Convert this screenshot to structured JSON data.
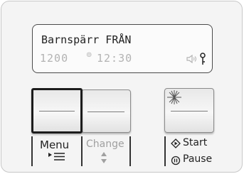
{
  "display": {
    "line1": "Barnspärr FRÅN",
    "spin_speed": "1200",
    "time": "12:30",
    "icons": [
      "spin-icon",
      "sound-icon",
      "key-icon"
    ]
  },
  "buttons": {
    "menu": {
      "label": "Menu",
      "icon": "menu-list-icon",
      "selected": true
    },
    "change": {
      "label": "Change",
      "icon": "up-down-arrows-icon",
      "enabled": false
    },
    "start_pause": {
      "label_start": "Start",
      "label_pause": "Pause",
      "icons": [
        "start-icon",
        "pause-icon"
      ]
    }
  },
  "colors": {
    "lcd_dim": "#b3b3b3",
    "text": "#222222",
    "disabled_text": "#a0a0a0"
  }
}
